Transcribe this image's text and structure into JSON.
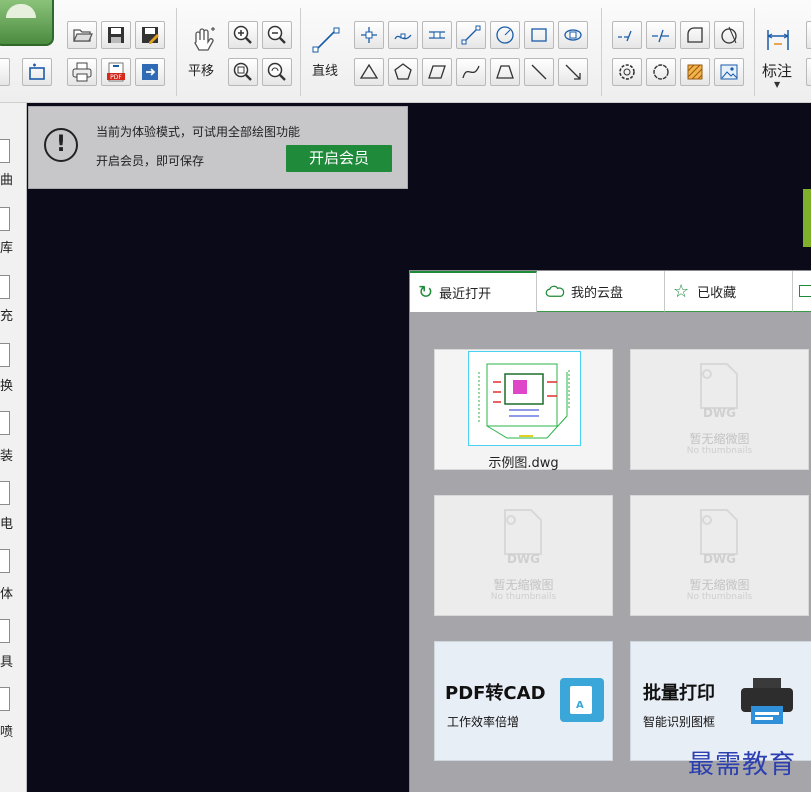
{
  "toolbar": {
    "pan_label": "平移",
    "line_label": "直线",
    "dimension_label": "标注"
  },
  "leftbar": {
    "items": [
      "曲",
      "库",
      "充",
      "换",
      "装",
      "电",
      "体",
      "具",
      "喷"
    ]
  },
  "banner": {
    "message": "当前为体验模式，可试用全部绘图功能",
    "save_hint": "开启会员，即可保存",
    "button_label": "开启会员"
  },
  "startpanel": {
    "tabs": [
      {
        "label": "最近打开",
        "icon": "refresh-icon"
      },
      {
        "label": "我的云盘",
        "icon": "cloud-icon"
      },
      {
        "label": "已收藏",
        "icon": "star-icon"
      }
    ],
    "recent_files": [
      {
        "name": "示例图.dwg",
        "has_thumbnail": true
      },
      {
        "name": "",
        "has_thumbnail": false
      },
      {
        "name": "",
        "has_thumbnail": false
      },
      {
        "name": "",
        "has_thumbnail": false
      }
    ],
    "placeholder_title": "暂无缩微图",
    "placeholder_sub": "No thumbnails",
    "placeholder_badge": "DWG",
    "promos": [
      {
        "title": "PDF转CAD",
        "subtitle": "工作效率倍增"
      },
      {
        "title": "批量打印",
        "subtitle": "智能识别图框"
      }
    ]
  },
  "watermark": "最需教育",
  "colors": {
    "accent_green": "#1e8a3a",
    "canvas": "#0b0a18",
    "watermark_blue": "#2c3fb0"
  }
}
